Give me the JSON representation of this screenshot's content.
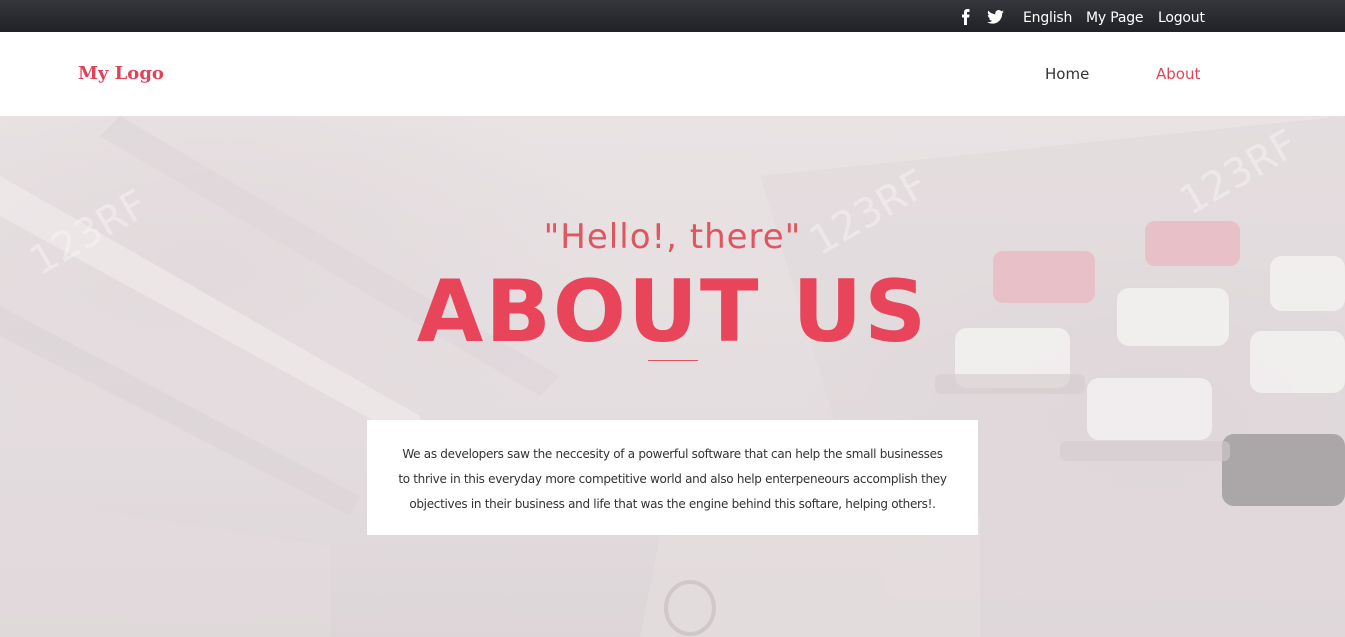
{
  "topbar": {
    "social_icons": [
      "facebook-icon",
      "twitter-icon"
    ],
    "language_label": "English",
    "mypage_label": "My Page",
    "logout_label": "Logout"
  },
  "header": {
    "logo_text": "My Logo",
    "nav": {
      "home_label": "Home",
      "about_label": "About"
    }
  },
  "hero": {
    "greeting": "\"Hello!, there\"",
    "title": "ABOUT US",
    "description": "We as developers saw the neccesity of a powerful software that can help the small businesses to thrive in this everyday more competitive world and also help enterpeneours accomplish they objectives in their business and life that was the engine behind this softare, helping others!."
  },
  "colors": {
    "accent": "#e8445a",
    "topbar_bg": "#2a2c31",
    "nav_text": "#333333"
  }
}
